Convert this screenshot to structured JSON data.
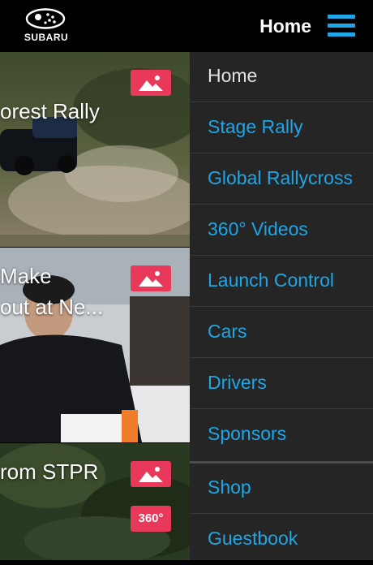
{
  "header": {
    "brand": "SUBARU",
    "title": "Home",
    "accent_color": "#1ea6e6",
    "menu_icon": "hamburger-menu-icon"
  },
  "feed": {
    "cards": [
      {
        "caption_line1": "orest Rally",
        "caption_line2": "",
        "badges": [
          "image-icon"
        ]
      },
      {
        "caption_line1": "Make",
        "caption_line2": "out at Ne...",
        "badges": [
          "image-icon"
        ]
      },
      {
        "caption_line1": "rom STPR",
        "caption_line2": "",
        "badges": [
          "image-icon",
          "360-video-icon"
        ],
        "badge_360_label": "360°"
      }
    ],
    "badge_color": "#e8395a"
  },
  "menu": {
    "items": [
      {
        "label": "Home",
        "active": true
      },
      {
        "label": "Stage Rally"
      },
      {
        "label": "Global Rallycross"
      },
      {
        "label": "360° Videos"
      },
      {
        "label": "Launch Control"
      },
      {
        "label": "Cars"
      },
      {
        "label": "Drivers"
      },
      {
        "label": "Sponsors"
      },
      {
        "label": "Shop"
      },
      {
        "label": "Guestbook"
      }
    ],
    "active_color": "#e0e0e0",
    "link_color": "#1ea6e6"
  }
}
